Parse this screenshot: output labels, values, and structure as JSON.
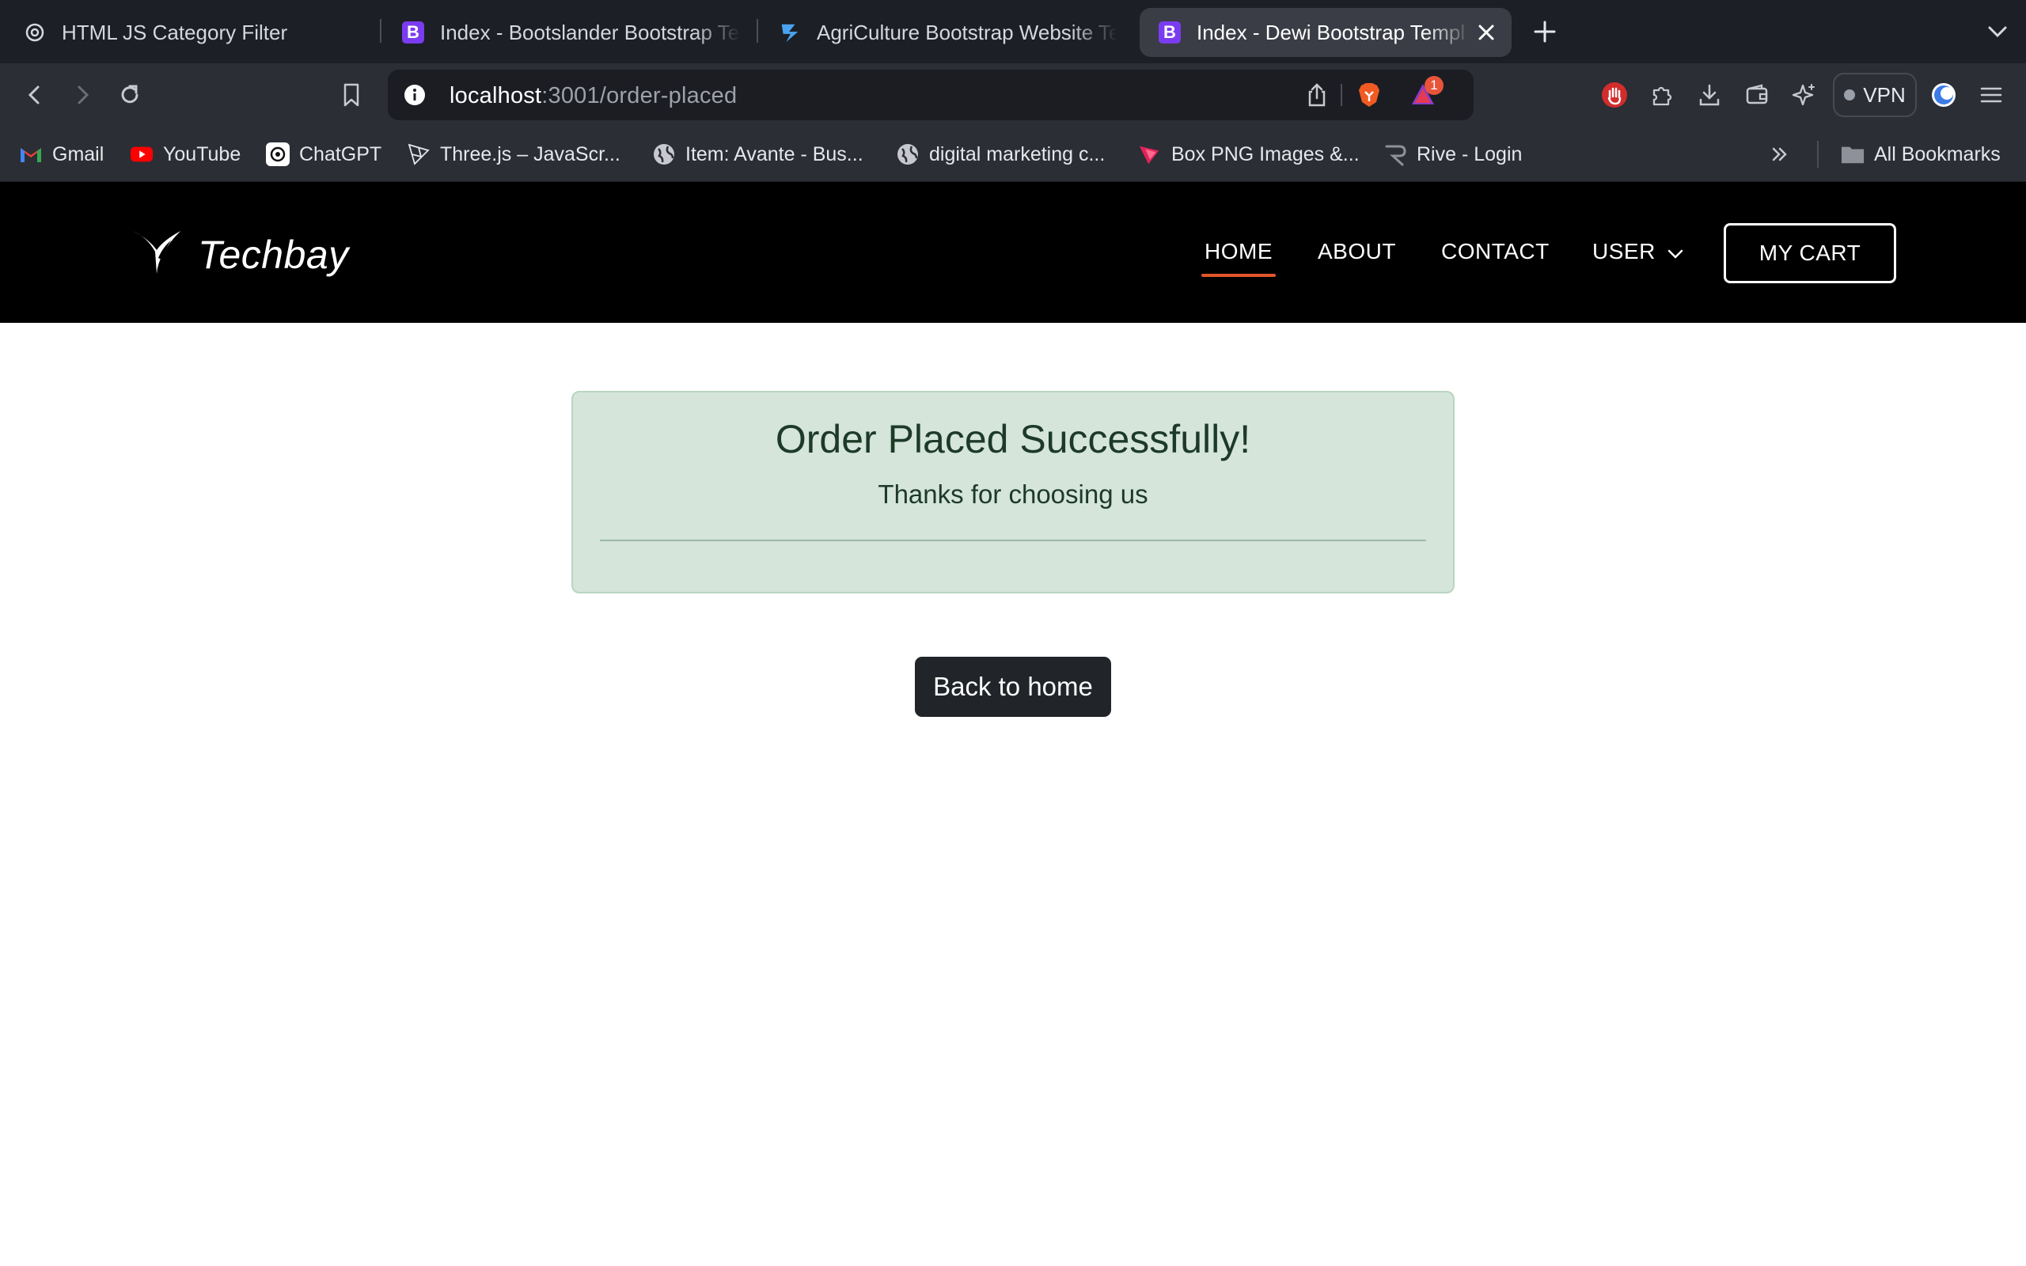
{
  "browser": {
    "tabs": [
      {
        "title": "HTML JS Category Filter",
        "icon": "chatgpt-icon",
        "active": false
      },
      {
        "title": "Index - Bootslander Bootstrap Template",
        "icon": "bootstrap-icon",
        "active": false
      },
      {
        "title": "AgriCulture Bootstrap Website Template",
        "icon": "brand-icon",
        "active": false
      },
      {
        "title": "Index - Dewi Bootstrap Template",
        "icon": "bootstrap-icon",
        "active": true
      }
    ],
    "fav_letter": "B",
    "url_host": "localhost",
    "url_path": ":3001/order-placed",
    "notification_badge": "1",
    "vpn_label": "VPN",
    "bookmarks": [
      {
        "label": "Gmail",
        "icon": "gmail-icon"
      },
      {
        "label": "YouTube",
        "icon": "youtube-icon"
      },
      {
        "label": "ChatGPT",
        "icon": "chatgpt-icon"
      },
      {
        "label": "Three.js – JavaScr...",
        "icon": "threejs-icon"
      },
      {
        "label": "Item: Avante - Bus...",
        "icon": "globe-icon"
      },
      {
        "label": "digital marketing c...",
        "icon": "globe-icon"
      },
      {
        "label": "Box PNG Images &...",
        "icon": "pngtree-icon"
      },
      {
        "label": "Rive - Login",
        "icon": "rive-icon"
      }
    ],
    "all_bookmarks_label": "All Bookmarks"
  },
  "site": {
    "brand": "Techbay",
    "nav": [
      {
        "label": "HOME",
        "active": true
      },
      {
        "label": "ABOUT",
        "active": false
      },
      {
        "label": "CONTACT",
        "active": false
      },
      {
        "label": "USER",
        "active": false,
        "dropdown": true
      }
    ],
    "cart_label": "MY CART",
    "accent_color": "#e2562b"
  },
  "content": {
    "title": "Order Placed Successfully!",
    "subtitle": "Thanks for choosing us",
    "back_button": "Back to home",
    "alert_bg": "#d5e5da"
  }
}
